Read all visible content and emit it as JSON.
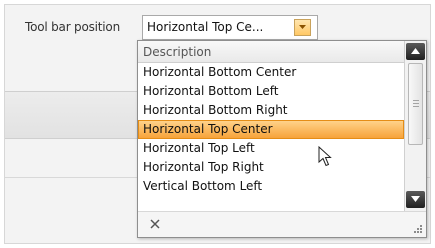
{
  "field": {
    "label": "Tool bar position",
    "selected_value": "Horizontal Top Ce..."
  },
  "dropdown": {
    "header": "Description",
    "items": [
      {
        "label": "Horizontal Bottom Center",
        "selected": false
      },
      {
        "label": "Horizontal Bottom Left",
        "selected": false
      },
      {
        "label": "Horizontal Bottom Right",
        "selected": false
      },
      {
        "label": "Horizontal Top Center",
        "selected": true
      },
      {
        "label": "Horizontal Top Left",
        "selected": false
      },
      {
        "label": "Horizontal Top Right",
        "selected": false
      },
      {
        "label": "Vertical Bottom Left",
        "selected": false
      }
    ],
    "clear_icon": "close-icon",
    "resize_icon": "resize-grip-icon"
  },
  "colors": {
    "selection_fill": "#f7a33a",
    "selection_border": "#e58d16",
    "combo_button": "#ffc866",
    "scroll_button": "#202020"
  },
  "icons": {
    "combo_button": "chevron-down-icon",
    "scroll_up": "arrow-up-icon",
    "scroll_down": "arrow-down-icon",
    "cursor": "mouse-pointer-icon"
  }
}
